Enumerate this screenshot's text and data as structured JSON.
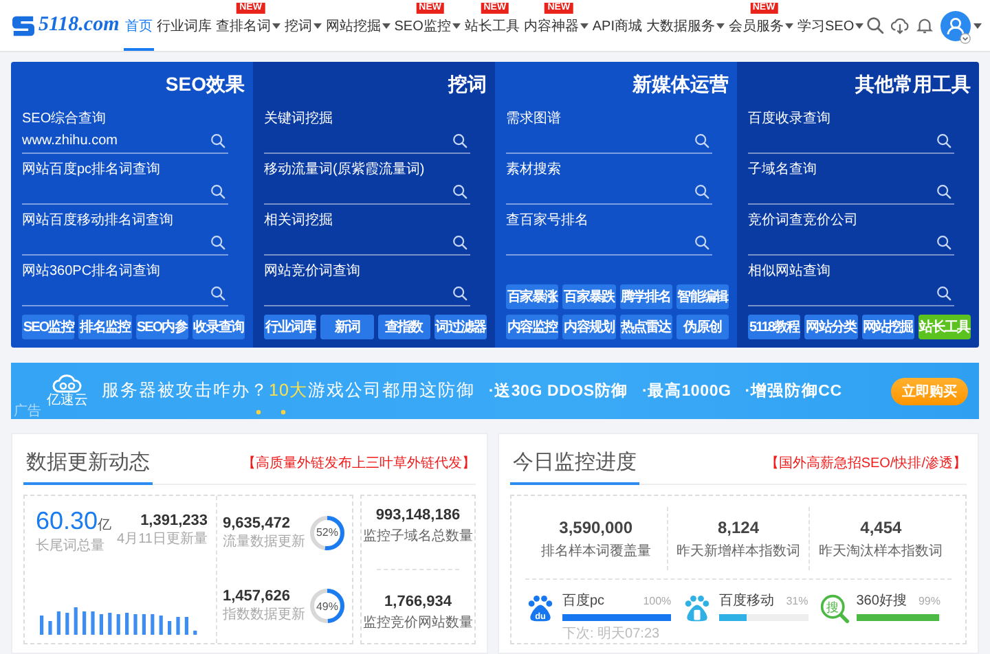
{
  "nav": {
    "logo": {
      "text": "5118.com"
    },
    "items": [
      {
        "label": "首页",
        "selected": true,
        "dropdown": false
      },
      {
        "label": "行业词库",
        "selected": false,
        "dropdown": false
      },
      {
        "label": "查排名词",
        "selected": false,
        "dropdown": true,
        "badge": "NEW"
      },
      {
        "label": "挖词",
        "selected": false,
        "dropdown": true
      },
      {
        "label": "网站挖掘",
        "selected": false,
        "dropdown": true
      },
      {
        "label": "SEO监控",
        "selected": false,
        "dropdown": true,
        "badge": "NEW"
      },
      {
        "label": "站长工具",
        "selected": false,
        "dropdown": false,
        "badge": "NEW"
      },
      {
        "label": "内容神器",
        "selected": false,
        "dropdown": true,
        "badge": "NEW"
      },
      {
        "label": "API商城",
        "selected": false,
        "dropdown": false
      },
      {
        "label": "大数据服务",
        "selected": false,
        "dropdown": true
      },
      {
        "label": "会员服务",
        "selected": false,
        "dropdown": true,
        "badge": "NEW"
      },
      {
        "label": "学习SEO",
        "selected": false,
        "dropdown": true
      }
    ]
  },
  "tools_panel": {
    "columns": [
      {
        "title": "SEO效果",
        "fields": [
          {
            "label": "SEO综合查询",
            "value": "www.zhihu.com"
          },
          {
            "label": "网站百度pc排名词查询"
          },
          {
            "label": "网站百度移动排名词查询"
          },
          {
            "label": "网站360PC排名词查询"
          }
        ],
        "buttons": [
          {
            "label": "SEO监控",
            "highlighted": false
          },
          {
            "label": "排名监控",
            "highlighted": false
          },
          {
            "label": "SEO内参",
            "highlighted": false
          },
          {
            "label": "收录查询",
            "highlighted": false
          }
        ]
      },
      {
        "title": "挖词",
        "fields": [
          {
            "label": "关键词挖掘"
          },
          {
            "label": "移动流量词(原紫霞流量词)"
          },
          {
            "label": "相关词挖掘"
          },
          {
            "label": "网站竞价词查询"
          }
        ],
        "buttons": [
          {
            "label": "行业词库",
            "highlighted": false
          },
          {
            "label": "新词",
            "highlighted": false
          },
          {
            "label": "查指数",
            "highlighted": false
          },
          {
            "label": "词过滤器",
            "highlighted": false
          }
        ]
      },
      {
        "title": "新媒体运营",
        "fields": [
          {
            "label": "需求图谱"
          },
          {
            "label": "素材搜索"
          },
          {
            "label": "查百家号排名"
          }
        ],
        "buttons": [
          {
            "label": "百家暴涨",
            "highlighted": false
          },
          {
            "label": "百家暴跌",
            "highlighted": false
          },
          {
            "label": "腾学排名",
            "highlighted": false
          },
          {
            "label": "智能编辑",
            "highlighted": false
          },
          {
            "label": "内容监控",
            "highlighted": false
          },
          {
            "label": "内容规划",
            "highlighted": false
          },
          {
            "label": "热点雷达",
            "highlighted": false
          },
          {
            "label": "伪原创",
            "highlighted": false
          }
        ]
      },
      {
        "title": "其他常用工具",
        "fields": [
          {
            "label": "百度收录查询"
          },
          {
            "label": "子域名查询"
          },
          {
            "label": "竞价词查竞价公司"
          },
          {
            "label": "相似网站查询"
          }
        ],
        "buttons": [
          {
            "label": "5118教程",
            "highlighted": false
          },
          {
            "label": "网站分类",
            "highlighted": false
          },
          {
            "label": "网站挖掘",
            "highlighted": false
          },
          {
            "label": "站长工具",
            "highlighted": true
          }
        ]
      }
    ]
  },
  "banner": {
    "logo_text": "亿速云",
    "ad_label": "广告",
    "headline": [
      {
        "text": "服务器被攻击咋办？",
        "highlight": false
      },
      {
        "text": "10大",
        "highlight": true
      },
      {
        "text": "游戏公司都用这防御",
        "highlight": false
      }
    ],
    "features": [
      "·送30G DDOS防御",
      "·最高1000G",
      "·增强防御CC"
    ],
    "button": "立即购买"
  },
  "data_updates": {
    "title": "数据更新动态",
    "promo": "【高质量外链发布上三叶草外链代发】",
    "total": {
      "value": "60.30",
      "unit": "亿",
      "label": "长尾词总量"
    },
    "daily": {
      "value": "1,391,233",
      "label": "4月11日更新量"
    },
    "updates": [
      {
        "value": "9,635,472",
        "label": "流量数据更新",
        "level": 0.52,
        "reading": "52%"
      },
      {
        "value": "1,457,626",
        "label": "指数数据更新",
        "level": 0.49,
        "reading": "49%"
      }
    ],
    "monitors": [
      {
        "value": "993,148,186",
        "label": "监控子域名总数量"
      },
      {
        "value": "1,766,934",
        "label": "监控竞价网站数量"
      }
    ]
  },
  "monitoring": {
    "title": "今日监控进度",
    "promo": "【国外高薪急招SEO/快排/渗透】",
    "stats": [
      {
        "value": "3,590,000",
        "label": "排名样本词覆盖量"
      },
      {
        "value": "8,124",
        "label": "昨天新增样本指数词"
      },
      {
        "value": "4,454",
        "label": "昨天淘汰样本指数词"
      }
    ],
    "engines": [
      {
        "name": "百度pc",
        "percent": "100%",
        "level": 1,
        "color": "#1677f0",
        "kind": "paw",
        "icon_text": "du",
        "note": "下次: 明天07:23"
      },
      {
        "name": "百度移动",
        "percent": "31%",
        "level": 0.31,
        "color": "#2fb1e6",
        "kind": "phone"
      },
      {
        "name": "360好搜",
        "percent": "99%",
        "level": 0.99,
        "color": "#4cb944",
        "kind": "magnifier",
        "icon_text": "搜"
      }
    ]
  }
}
